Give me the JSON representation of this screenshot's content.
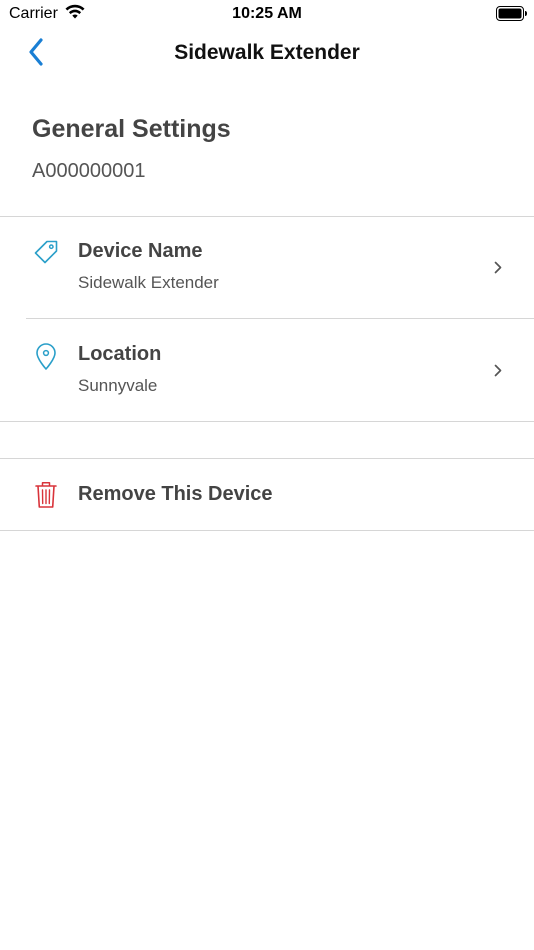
{
  "status_bar": {
    "carrier": "Carrier",
    "time": "10:25 AM",
    "wifi_icon": "wifi-icon",
    "battery_icon": "battery-icon"
  },
  "nav": {
    "back_icon": "chevron-left-icon",
    "title": "Sidewalk Extender"
  },
  "settings": {
    "title": "General Settings",
    "device_id": "A000000001"
  },
  "rows": [
    {
      "icon": "tag-icon",
      "label": "Device Name",
      "value": "Sidewalk Extender",
      "chevron": "chevron-right-icon"
    },
    {
      "icon": "location-pin-icon",
      "label": "Location",
      "value": "Sunnyvale",
      "chevron": "chevron-right-icon"
    }
  ],
  "remove": {
    "icon": "trash-icon",
    "label": "Remove This Device"
  },
  "colors": {
    "accent": "#1a7fd4",
    "icon_teal": "#2a9fc9",
    "danger": "#d9333a",
    "divider": "#d6d6d6"
  }
}
